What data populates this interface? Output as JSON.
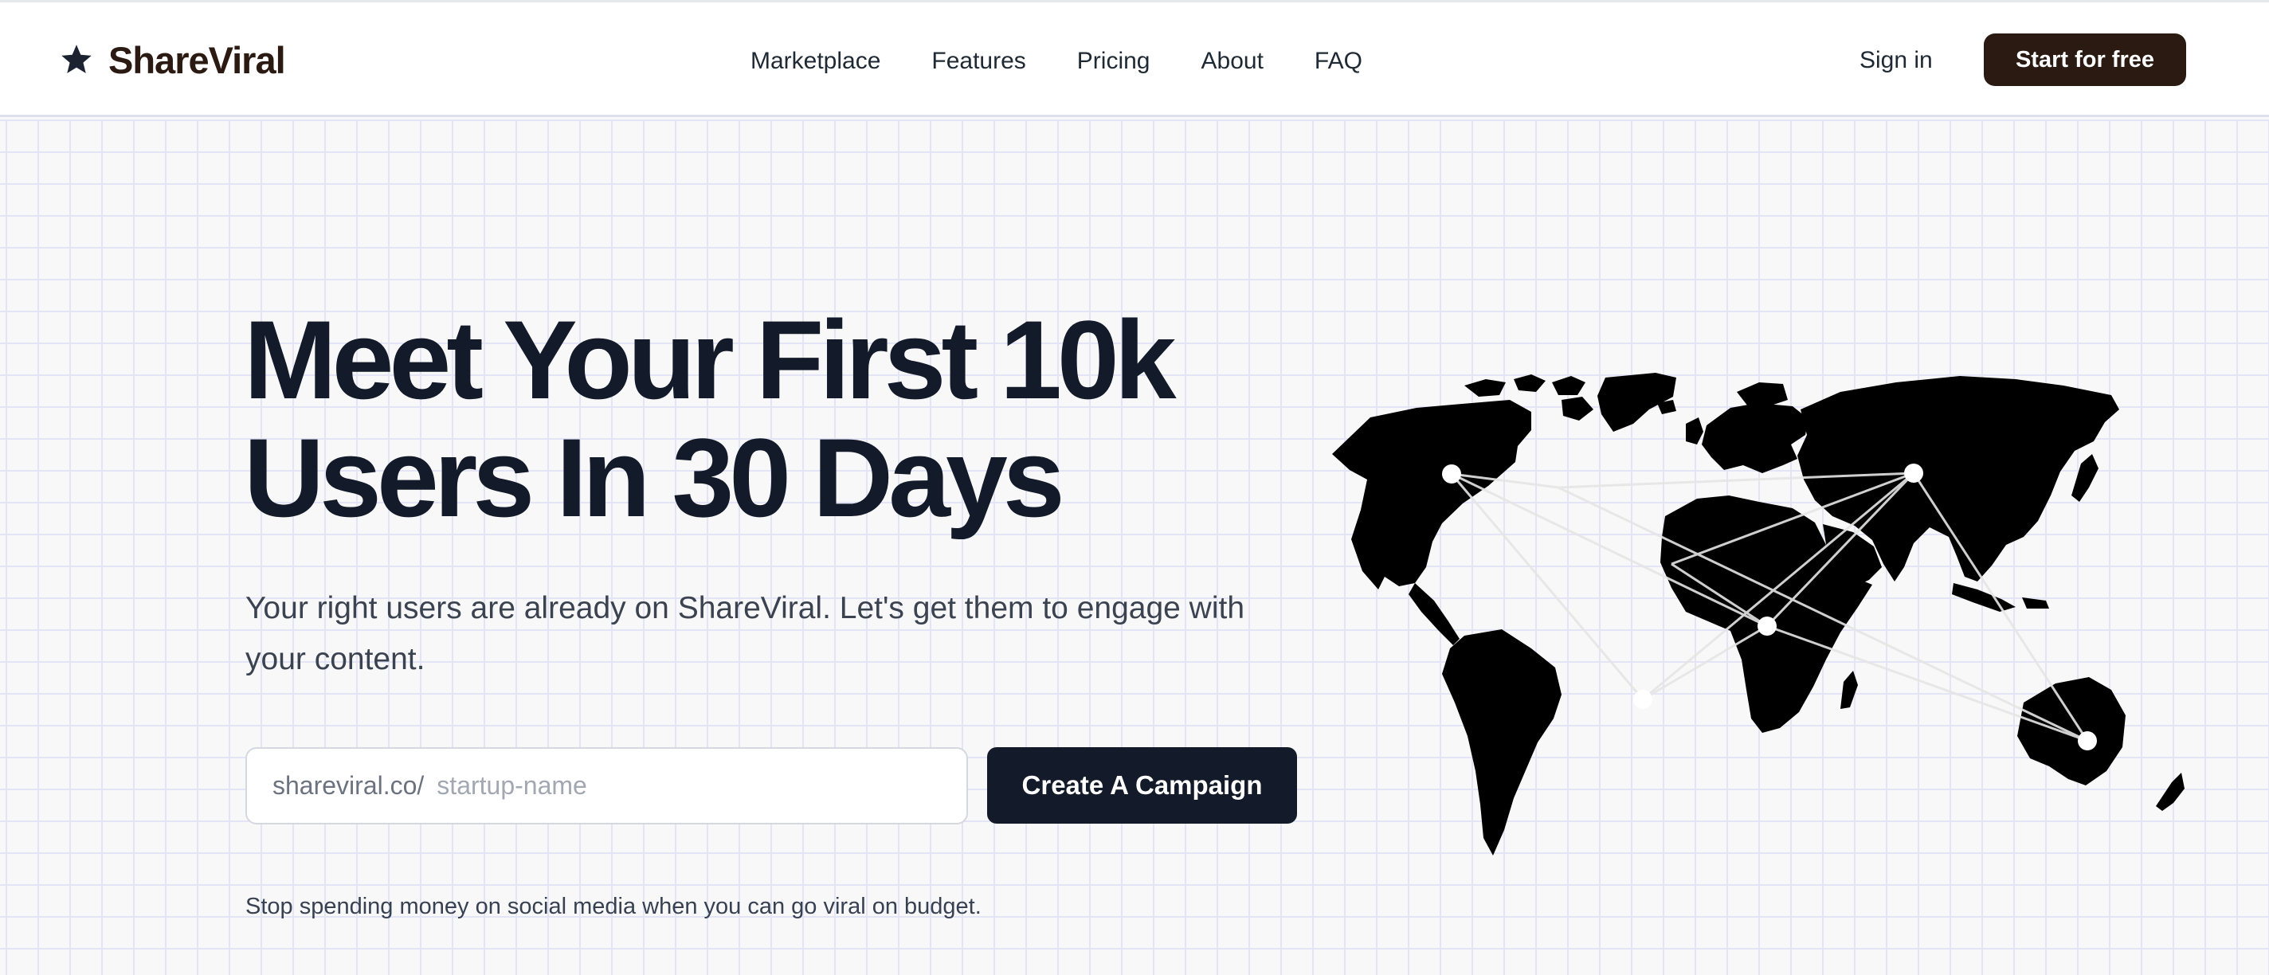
{
  "brand": {
    "name": "ShareViral",
    "logo_icon": "star-icon",
    "color": "#2a1a12"
  },
  "nav": {
    "items": [
      {
        "label": "Marketplace"
      },
      {
        "label": "Features"
      },
      {
        "label": "Pricing"
      },
      {
        "label": "About"
      },
      {
        "label": "FAQ"
      }
    ],
    "sign_in": "Sign in",
    "cta": "Start for free"
  },
  "hero": {
    "title_line1": "Meet Your First 10k",
    "title_line2": "Users In 30 Days",
    "subtitle": "Your right users are already on ShareViral. Let's get them to engage with your content.",
    "url_prefix": "shareviral.co/",
    "input_placeholder": "startup-name",
    "create_button": "Create A Campaign",
    "tagline": "Stop spending money on social media when you can go viral on budget."
  },
  "illustration": {
    "icon": "world-map-network-icon"
  },
  "colors": {
    "dark_navy": "#131a29",
    "dark_brown": "#2a1a12",
    "grid_line": "#e3e5f6",
    "background": "#f8f8f9"
  }
}
